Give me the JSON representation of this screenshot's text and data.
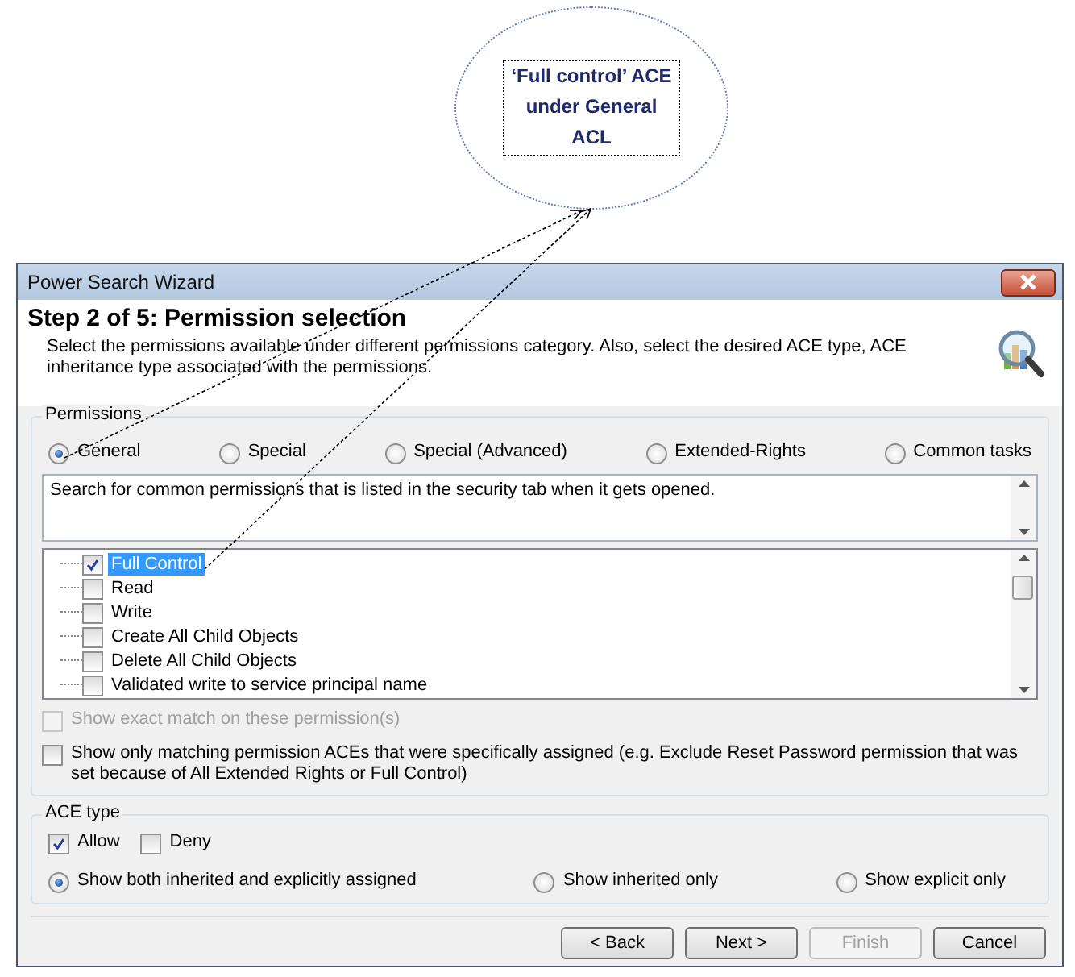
{
  "callout": {
    "text": "‘Full control’ ACE under General ACL"
  },
  "window": {
    "title": "Power Search Wizard"
  },
  "header": {
    "title": "Step 2 of 5:  Permission selection",
    "description": "Select the permissions available under different permissions category. Also, select the desired ACE type, ACE inheritance type associated with the permissions."
  },
  "permissions": {
    "label": "Permissions",
    "categories": [
      {
        "label": "General",
        "selected": true
      },
      {
        "label": "Special",
        "selected": false
      },
      {
        "label": "Special (Advanced)",
        "selected": false
      },
      {
        "label": "Extended-Rights",
        "selected": false
      },
      {
        "label": "Common tasks",
        "selected": false
      }
    ],
    "description": "Search for common permissions that is listed in the security tab when it gets opened.",
    "items": [
      {
        "label": "Full Control",
        "checked": true,
        "selected": true
      },
      {
        "label": "Read",
        "checked": false,
        "selected": false
      },
      {
        "label": "Write",
        "checked": false,
        "selected": false
      },
      {
        "label": "Create All Child Objects",
        "checked": false,
        "selected": false
      },
      {
        "label": "Delete All Child Objects",
        "checked": false,
        "selected": false
      },
      {
        "label": "Validated write to service principal name",
        "checked": false,
        "selected": false
      }
    ],
    "exact_match": {
      "label": "Show exact match on these permission(s)",
      "checked": false,
      "disabled": true
    },
    "specific_only": {
      "label": "Show only matching permission ACEs that were specifically assigned (e.g. Exclude Reset Password permission that was set because of All Extended Rights or Full Control)",
      "checked": false,
      "disabled": false
    }
  },
  "ace_type": {
    "label": "ACE type",
    "types": [
      {
        "label": "Allow",
        "checked": true
      },
      {
        "label": "Deny",
        "checked": false
      }
    ],
    "inheritance": [
      {
        "label": "Show both inherited and explicitly assigned",
        "selected": true
      },
      {
        "label": "Show inherited only",
        "selected": false
      },
      {
        "label": "Show explicit only",
        "selected": false
      }
    ]
  },
  "buttons": [
    {
      "label": "< Back",
      "disabled": false
    },
    {
      "label": "Next >",
      "disabled": false
    },
    {
      "label": "Finish",
      "disabled": true
    },
    {
      "label": "Cancel",
      "disabled": false
    }
  ]
}
